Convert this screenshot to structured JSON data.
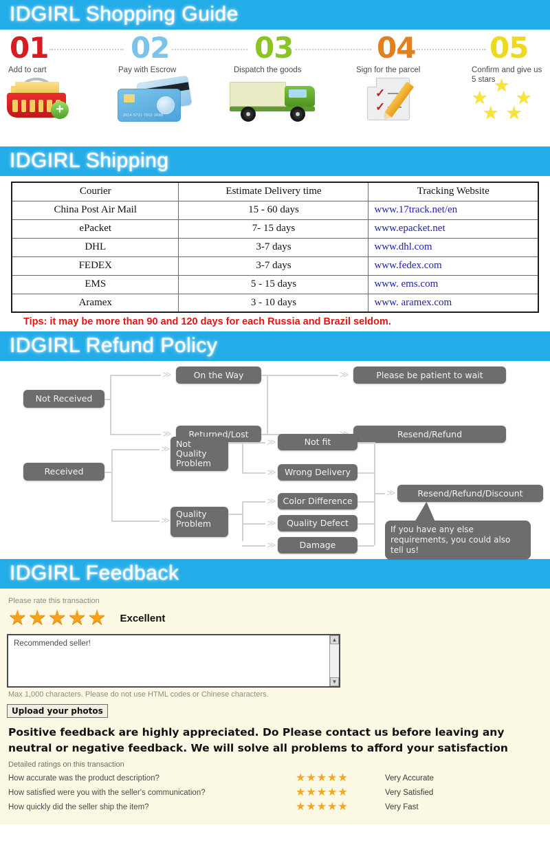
{
  "sections": {
    "guide_title": "IDGIRL Shopping Guide",
    "shipping_title": "IDGIRL Shipping",
    "refund_title": "IDGIRL Refund Policy",
    "feedback_title": "IDGIRL Feedback"
  },
  "colors": {
    "banner_bg": "#22ACE8",
    "banner_text": "#FFFFFF",
    "step01": "#D41E22",
    "step02": "#7CC3EA",
    "step03": "#8CC425",
    "step04": "#E08020",
    "step05": "#EDDA1E",
    "tips_red": "#EE1111",
    "link_blue": "#2222AA",
    "flow_box": "#6D6D6D",
    "flow_line": "#D2D2D2",
    "feedback_bg": "#FBF8E3",
    "star_orange": "#F7A11A"
  },
  "steps": [
    {
      "num": "01",
      "label": "Add to cart",
      "icon": "shopping-basket-icon"
    },
    {
      "num": "02",
      "label": "Pay with Escrow",
      "icon": "credit-card-icon"
    },
    {
      "num": "03",
      "label": "Dispatch the goods",
      "icon": "delivery-truck-icon"
    },
    {
      "num": "04",
      "label": "Sign for the parcel",
      "icon": "sign-document-icon"
    },
    {
      "num": "05",
      "label": "Confirm and give us 5 stars",
      "icon": "five-stars-icon"
    }
  ],
  "card_number": "2014 5721 7912 3698",
  "shipping_table": {
    "headers": [
      "Courier",
      "Estimate Delivery time",
      "Tracking Website"
    ],
    "rows": [
      [
        "China Post Air Mail",
        "15 - 60 days",
        "www.17track.net/en"
      ],
      [
        "ePacket",
        "7- 15 days",
        "www.epacket.net"
      ],
      [
        "DHL",
        "3-7 days",
        "www.dhl.com"
      ],
      [
        "FEDEX",
        "3-7 days",
        "www.fedex.com"
      ],
      [
        "EMS",
        "5 - 15 days",
        "www. ems.com"
      ],
      [
        "Aramex",
        "3 - 10 days",
        "www. aramex.com"
      ]
    ],
    "tips": "Tips: it may be more than 90 and 120 days for each Russia and Brazil seldom."
  },
  "flowchart": {
    "not_received": "Not Received",
    "on_the_way": "On the Way",
    "returned_lost": "Returned/Lost",
    "be_patient": "Please be patient to wait",
    "resend_refund": "Resend/Refund",
    "received": "Received",
    "not_quality_problem": "Not Quality Problem",
    "quality_problem": "Quality Problem",
    "not_fit": "Not fit",
    "wrong_delivery": "Wrong Delivery",
    "color_difference": "Color Difference",
    "quality_defect": "Quality Defect",
    "damage": "Damage",
    "resend_refund_discount": "Resend/Refund/Discount",
    "callout": "If you have any else requirements, you could also tell us!",
    "arrow_glyph": "≫"
  },
  "feedback": {
    "rate_prompt": "Please rate this transaction",
    "stars": "★★★★★",
    "rating_label": "Excellent",
    "comment_value": "Recommended seller!",
    "max_note": "Max 1,000 characters. Please do not use HTML codes or Chinese characters.",
    "upload_button": "Upload your photos",
    "scroll_up": "▲",
    "scroll_down": "▼",
    "big_note": "Positive feedback are highly appreciated. Do Please contact us before leaving any neutral or negative feedback. We will solve all problems to afford your satisfaction",
    "detail_title": "Detailed ratings on this transaction",
    "detail_rows": [
      {
        "question": "How accurate was the product description?",
        "stars": "★★★★★",
        "verdict": "Very Accurate"
      },
      {
        "question": "How satisfied were you with the seller's communication?",
        "stars": "★★★★★",
        "verdict": "Very Satisfied"
      },
      {
        "question": "How quickly did the seller ship the item?",
        "stars": "★★★★★",
        "verdict": "Very Fast"
      }
    ]
  }
}
